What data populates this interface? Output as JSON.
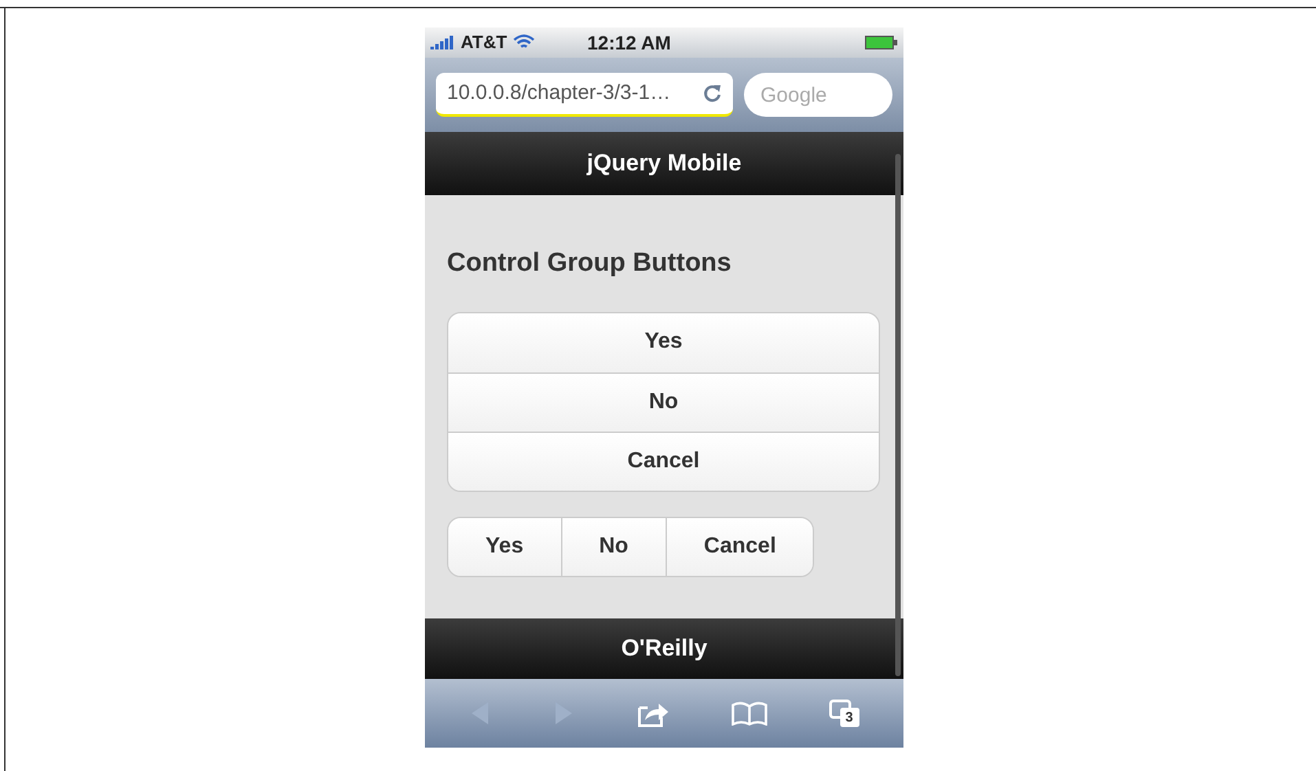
{
  "status_bar": {
    "carrier": "AT&T",
    "time": "12:12 AM"
  },
  "address_bar": {
    "url": "10.0.0.8/chapter-3/3-1…",
    "search_placeholder": "Google"
  },
  "header": {
    "title": "jQuery Mobile"
  },
  "content": {
    "heading": "Control Group Buttons",
    "vertical_group": [
      {
        "label": "Yes"
      },
      {
        "label": "No"
      },
      {
        "label": "Cancel"
      }
    ],
    "horizontal_group": [
      {
        "label": "Yes"
      },
      {
        "label": "No"
      },
      {
        "label": "Cancel"
      }
    ]
  },
  "footer": {
    "title": "O'Reilly"
  },
  "toolbar": {
    "back_disabled": true,
    "forward_disabled": true,
    "tab_count": "3"
  }
}
